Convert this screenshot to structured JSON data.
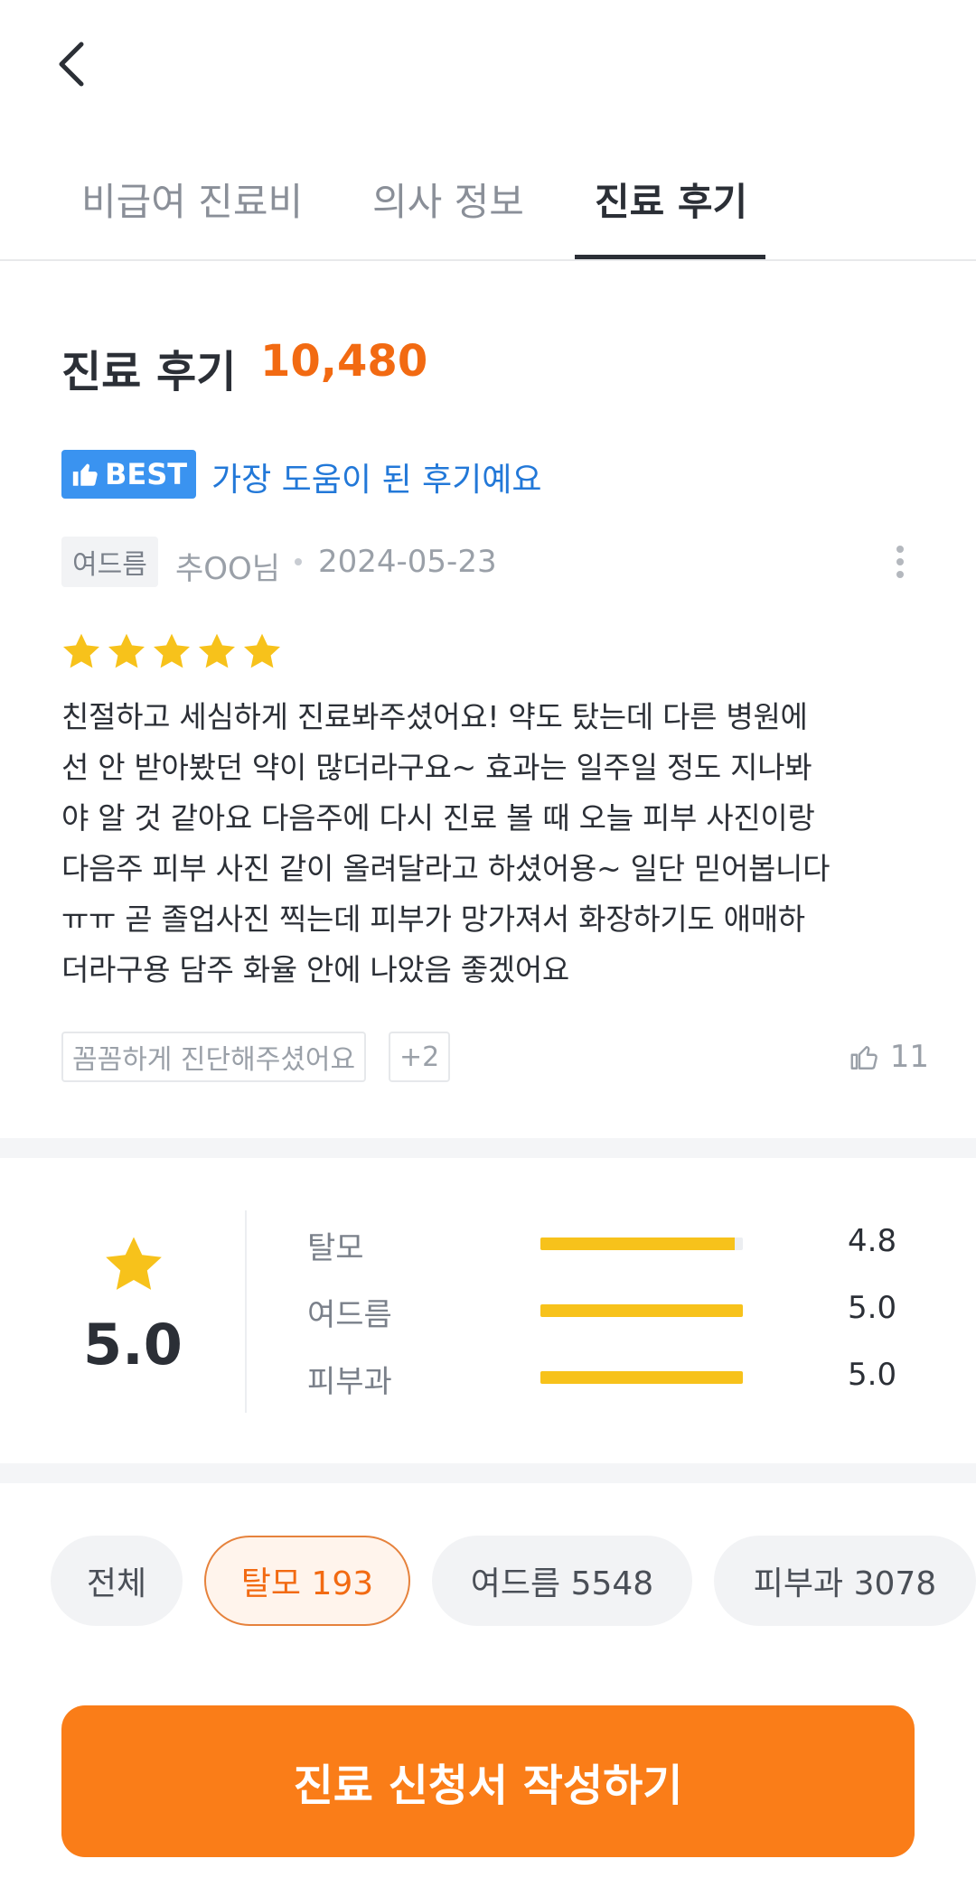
{
  "header": {
    "back_icon": "chevron-left-icon"
  },
  "tabs": [
    {
      "label": "비급여 진료비",
      "active": false
    },
    {
      "label": "의사 정보",
      "active": false
    },
    {
      "label": "진료 후기",
      "active": true
    }
  ],
  "reviews_section": {
    "title": "진료 후기",
    "count": "10,480"
  },
  "best_review": {
    "badge_label": "BEST",
    "badge_icon": "thumbs-up-icon",
    "headline": "가장 도움이 된 후기예요",
    "category": "여드름",
    "author": "추OO님",
    "date": "2024-05-23",
    "rating": 5,
    "body_lines": [
      "친절하고 세심하게 진료봐주셨어요! 약도 탔는데 다른 병원에",
      "선 안 받아봤던 약이 많더라구요~ 효과는 일주일 정도 지나봐",
      "야 알 것 같아요 다음주에 다시 진료 볼 때 오늘 피부 사진이랑",
      "다음주 피부 사진 같이 올려달라고 하셨어용~ 일단 믿어봅니다",
      "ㅠㅠ 곧 졸업사진 찍는데 피부가 망가져서 화장하기도 애매하",
      "더라구용 담주 화율 안에 나았음 좋겠어요"
    ],
    "tags": [
      "꼼꼼하게 진단해주셨어요",
      "+2"
    ],
    "like_count": "11"
  },
  "rating_summary": {
    "overall": "5.0",
    "star_color": "#f7c21b",
    "categories": [
      {
        "name": "탈모",
        "score": "4.8",
        "fraction": 0.96
      },
      {
        "name": "여드름",
        "score": "5.0",
        "fraction": 1.0
      },
      {
        "name": "피부과",
        "score": "5.0",
        "fraction": 1.0
      }
    ]
  },
  "filters": [
    {
      "label": "전체",
      "selected": false
    },
    {
      "label": "탈모 193",
      "selected": true
    },
    {
      "label": "여드름 5548",
      "selected": false
    },
    {
      "label": "피부과 3078",
      "selected": false
    }
  ],
  "cta": {
    "label": "진료 신청서 작성하기"
  },
  "colors": {
    "accent": "#fa7d18",
    "best_blue": "#3a93f0",
    "link_blue": "#2278d8",
    "star": "#f7c21b"
  }
}
